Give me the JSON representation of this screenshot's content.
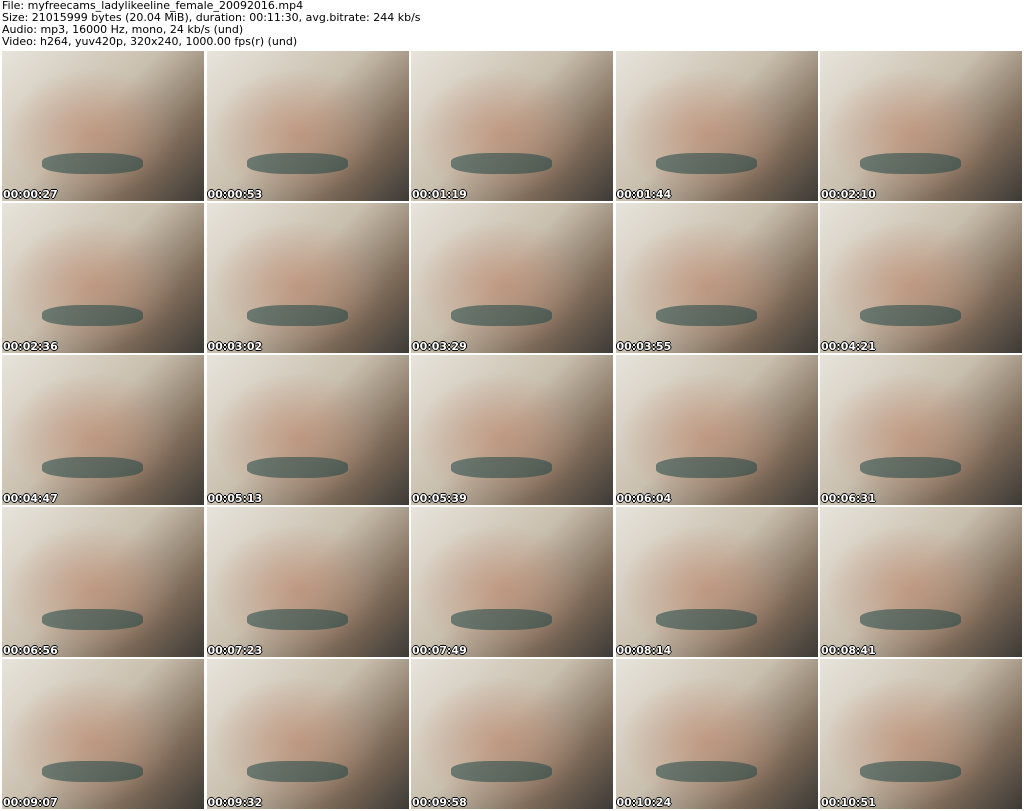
{
  "header": {
    "file": "File: myfreecams_ladylikeeline_female_20092016.mp4",
    "size": "Size: 21015999 bytes (20.04 MiB), duration: 00:11:30, avg.bitrate: 244 kb/s",
    "audio": "Audio: mp3, 16000 Hz, mono, 24 kb/s (und)",
    "video": "Video: h264, yuv420p, 320x240, 1000.00 fps(r) (und)"
  },
  "thumbnails": [
    "00:00:27",
    "00:00:53",
    "00:01:19",
    "00:01:44",
    "00:02:10",
    "00:02:36",
    "00:03:02",
    "00:03:29",
    "00:03:55",
    "00:04:21",
    "00:04:47",
    "00:05:13",
    "00:05:39",
    "00:06:04",
    "00:06:31",
    "00:06:56",
    "00:07:23",
    "00:07:49",
    "00:08:14",
    "00:08:41",
    "00:09:07",
    "00:09:32",
    "00:09:58",
    "00:10:24",
    "00:10:51"
  ]
}
